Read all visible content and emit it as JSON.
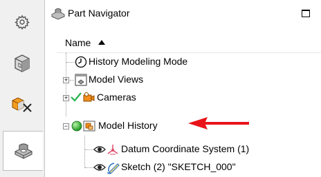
{
  "resource_bar": {
    "items": [
      {
        "icon": "gear-icon",
        "active": false
      },
      {
        "icon": "cube-assembly-icon",
        "active": false
      },
      {
        "icon": "constraint-navigator-icon",
        "active": false
      },
      {
        "icon": "part-navigator-icon",
        "active": true
      }
    ]
  },
  "navigator": {
    "title": "Part Navigator",
    "column_header": "Name",
    "rows": [
      {
        "label": "History Modeling Mode",
        "icon": "clock-icon"
      },
      {
        "label": "Model Views",
        "icon": "model-views-icon",
        "expandable": true,
        "expanded": false
      },
      {
        "label": "Cameras",
        "icon": "camera-icon",
        "check": "green-check-icon",
        "expandable": true,
        "expanded": false
      },
      {
        "label": "Model History",
        "icon": "model-history-icon",
        "status": "green-status-dot-icon",
        "expandable": true,
        "expanded": true
      },
      {
        "label": "Datum Coordinate System (1)",
        "icon": "datum-csys-icon",
        "visibility": "eye-icon"
      },
      {
        "label": "Sketch (2) \"SKETCH_000\"",
        "icon": "sketch-icon",
        "visibility": "eye-icon"
      }
    ]
  },
  "annotation": {
    "arrow_color": "#e8141a"
  },
  "colors": {
    "accent_green": "#22b14c",
    "orange": "#f28c1c",
    "blue": "#2d6fc6"
  }
}
